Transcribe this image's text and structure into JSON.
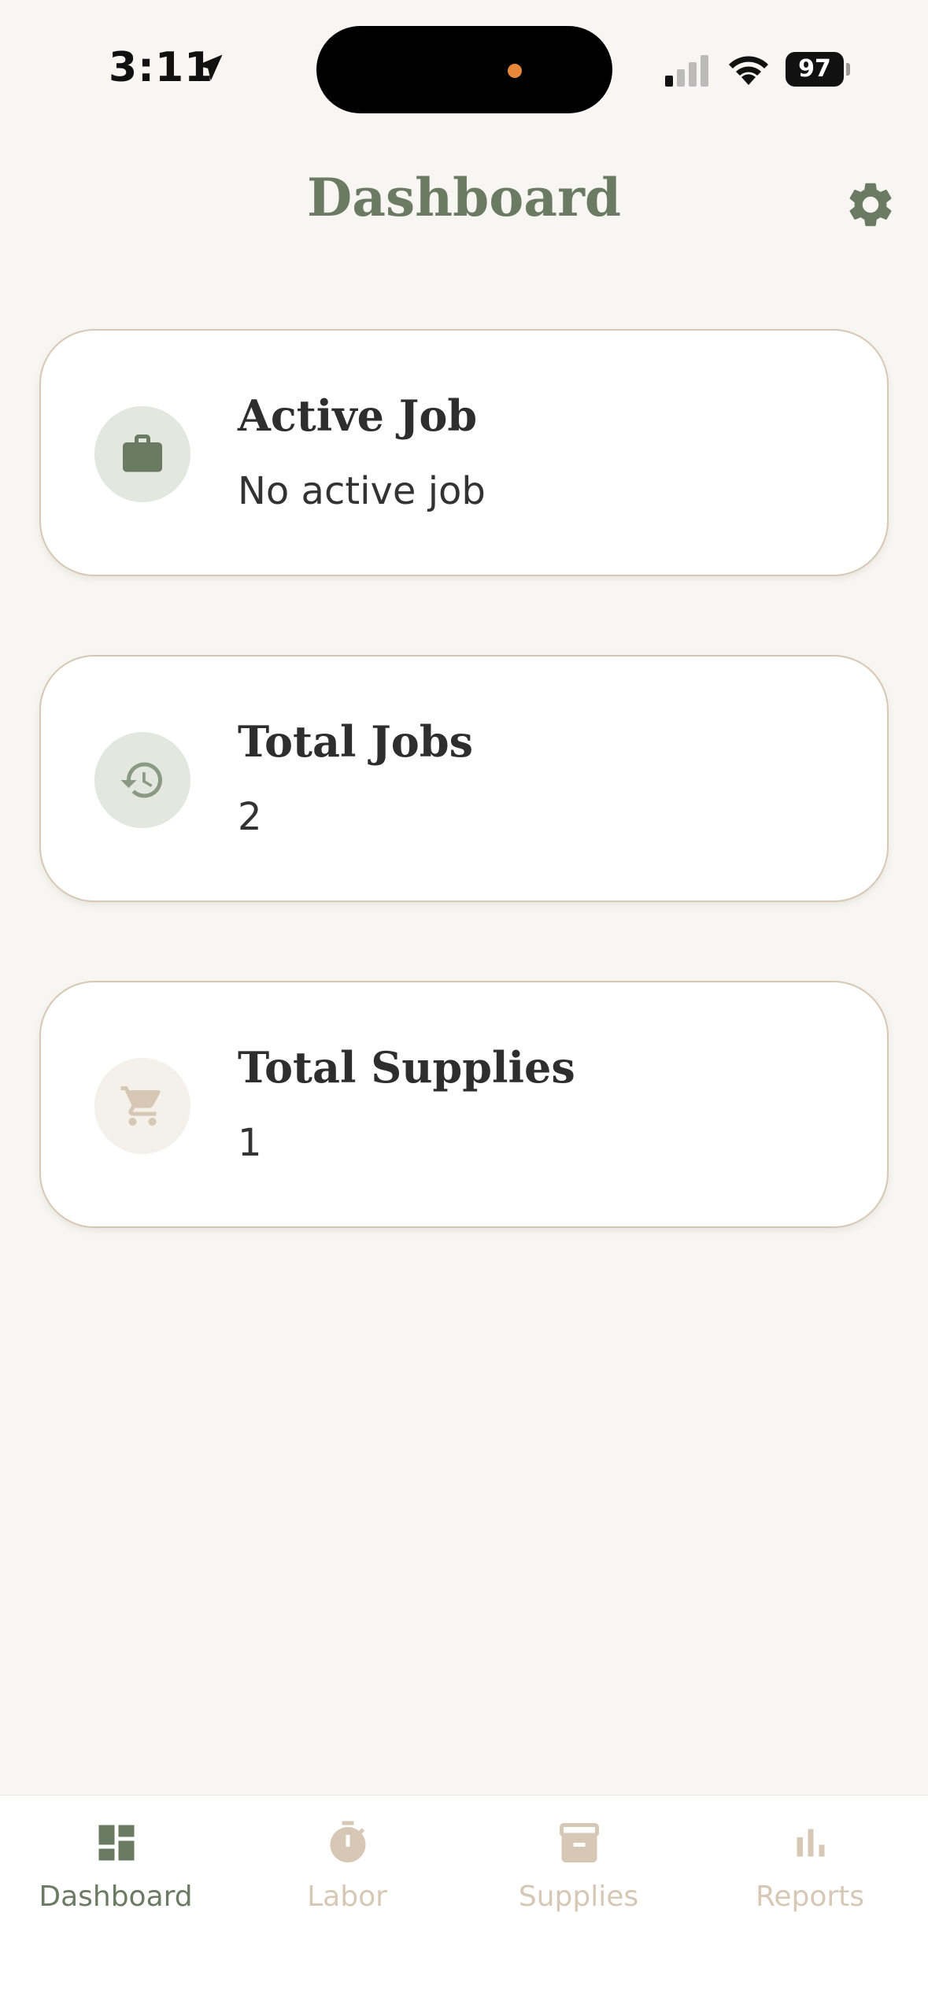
{
  "status_bar": {
    "time": "3:11",
    "battery": "97"
  },
  "header": {
    "title": "Dashboard",
    "settings_icon": "gear-icon"
  },
  "cards": [
    {
      "title": "Active Job",
      "value": "No active job",
      "icon": "briefcase-icon"
    },
    {
      "title": "Total Jobs",
      "value": "2",
      "icon": "history-icon"
    },
    {
      "title": "Total Supplies",
      "value": "1",
      "icon": "cart-icon"
    }
  ],
  "tab_bar": {
    "tabs": [
      {
        "label": "Dashboard",
        "icon": "dashboard-icon",
        "active": true
      },
      {
        "label": "Labor",
        "icon": "stopwatch-icon",
        "active": false
      },
      {
        "label": "Supplies",
        "icon": "archive-box-icon",
        "active": false
      },
      {
        "label": "Reports",
        "icon": "bar-chart-icon",
        "active": false
      }
    ]
  },
  "colors": {
    "accent": "#6b7b63",
    "inactive_tab": "#d6c8b4",
    "background": "#f7f6f2",
    "card_border": "#d6c8b4"
  }
}
